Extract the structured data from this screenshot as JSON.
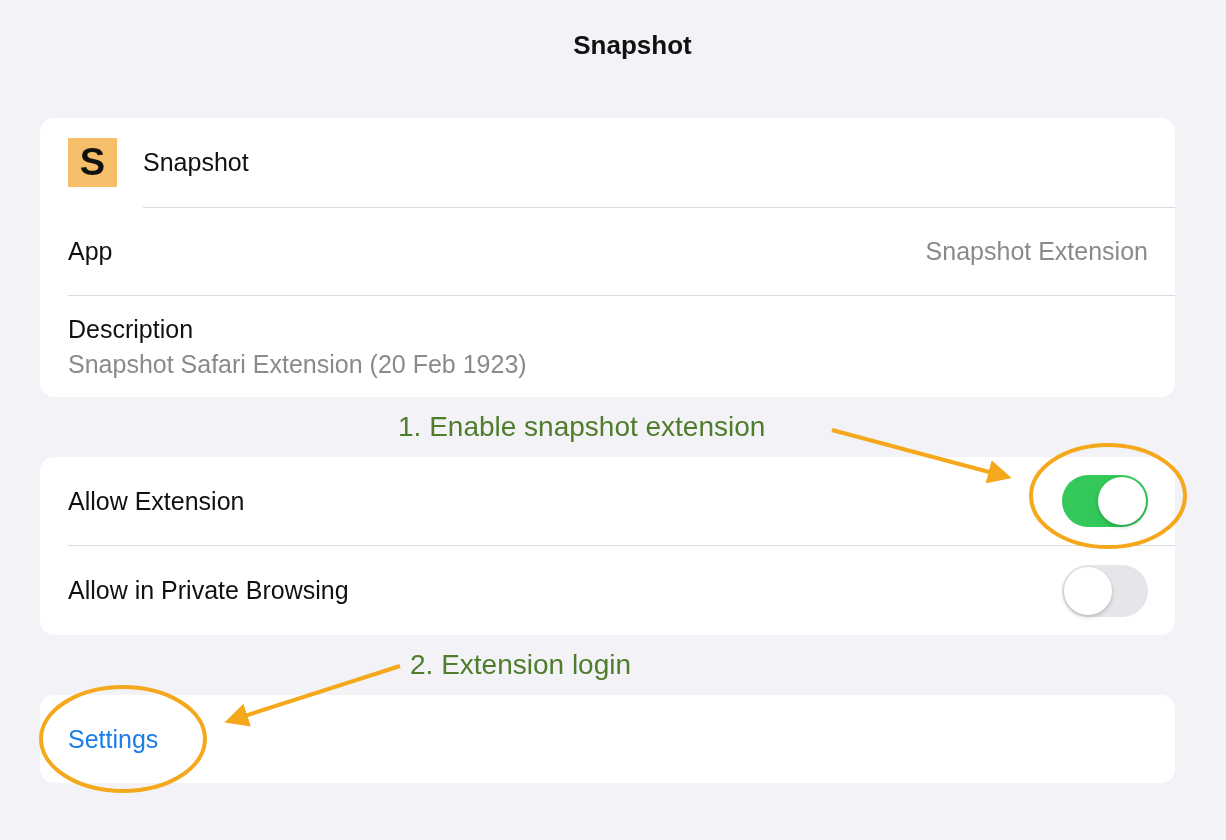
{
  "title": "Snapshot",
  "extension": {
    "icon_letter": "S",
    "name": "Snapshot"
  },
  "app": {
    "label": "App",
    "value": "Snapshot Extension"
  },
  "description": {
    "label": "Description",
    "value": "Snapshot Safari Extension (20 Feb 1923)"
  },
  "annotations": [
    {
      "text": "1. Enable snapshot extension"
    },
    {
      "text": "2. Extension login"
    }
  ],
  "toggles": [
    {
      "label": "Allow Extension",
      "on": true
    },
    {
      "label": "Allow in Private Browsing",
      "on": false
    }
  ],
  "settings_link": "Settings"
}
